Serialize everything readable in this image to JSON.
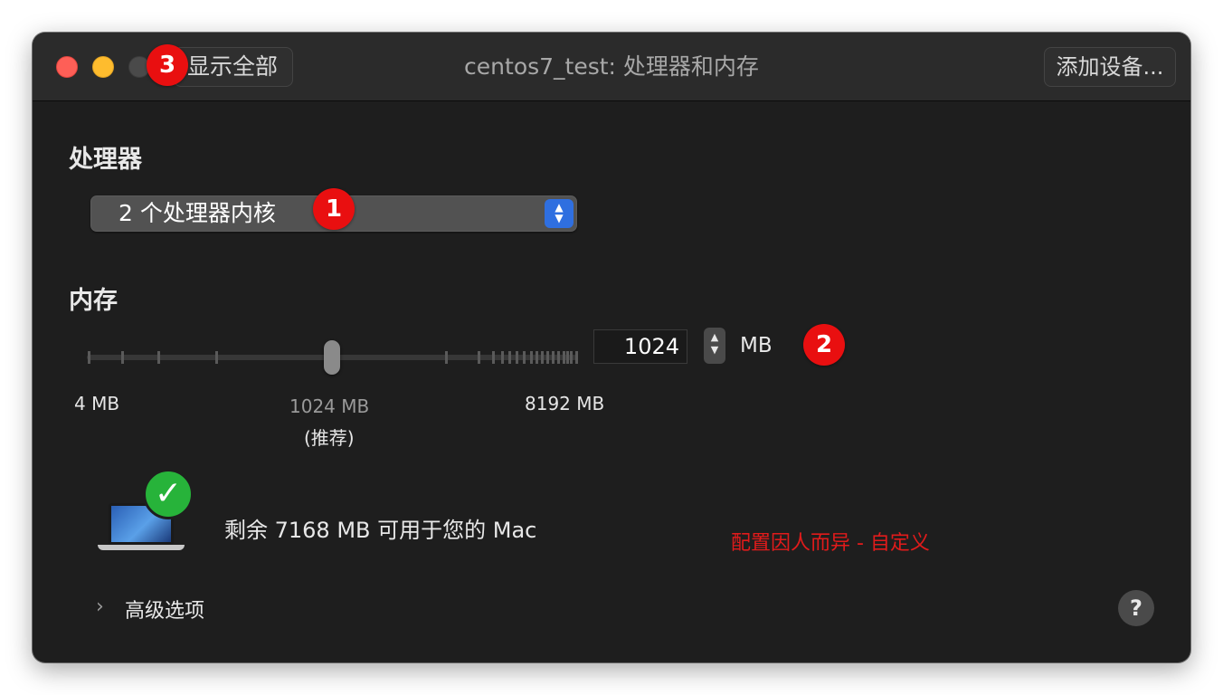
{
  "window": {
    "title": "centos7_test: 处理器和内存",
    "show_all_label": "显示全部",
    "add_device_label": "添加设备..."
  },
  "processor": {
    "heading": "处理器",
    "selected": "2 个处理器内核"
  },
  "memory": {
    "heading": "内存",
    "slider": {
      "min_label": "4 MB",
      "recommended_value_label": "1024 MB",
      "recommended_caption": "(推荐)",
      "max_label": "8192 MB",
      "position_fraction": 0.5
    },
    "value": "1024",
    "unit": "MB"
  },
  "status": {
    "available_text": "剩余 7168 MB 可用于您的 Mac"
  },
  "advanced_label": "高级选项",
  "help_label": "?",
  "annotations": {
    "badge_1": "1",
    "badge_2": "2",
    "badge_3": "3",
    "note": "配置因人而异 - 自定义"
  },
  "colors": {
    "window_bg": "#1e1e1e",
    "titlebar_bg": "#2b2b2b",
    "select_accent": "#2f6fe0",
    "badge_red": "#e90f10",
    "check_green": "#27b33a",
    "note_red": "#e11b1b"
  },
  "icons": {
    "close": "close-icon",
    "minimize": "minimize-icon",
    "zoom": "zoom-icon",
    "select_arrows": "up-down-arrows-icon",
    "stepper": "stepper-icon",
    "laptop": "laptop-icon",
    "checkmark": "checkmark-icon",
    "chevron": "chevron-right-icon",
    "help": "question-icon"
  }
}
